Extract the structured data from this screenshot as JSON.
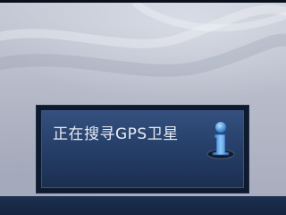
{
  "dialog": {
    "message": "正在搜寻GPS卫星",
    "icon": "info-icon"
  },
  "colors": {
    "wallpaper": "#b8bcca",
    "dialog_bg": "#27406a",
    "dialog_border": "#0e1a2e",
    "bottom_bar": "#1c3050",
    "text": "#e8ecf4"
  }
}
